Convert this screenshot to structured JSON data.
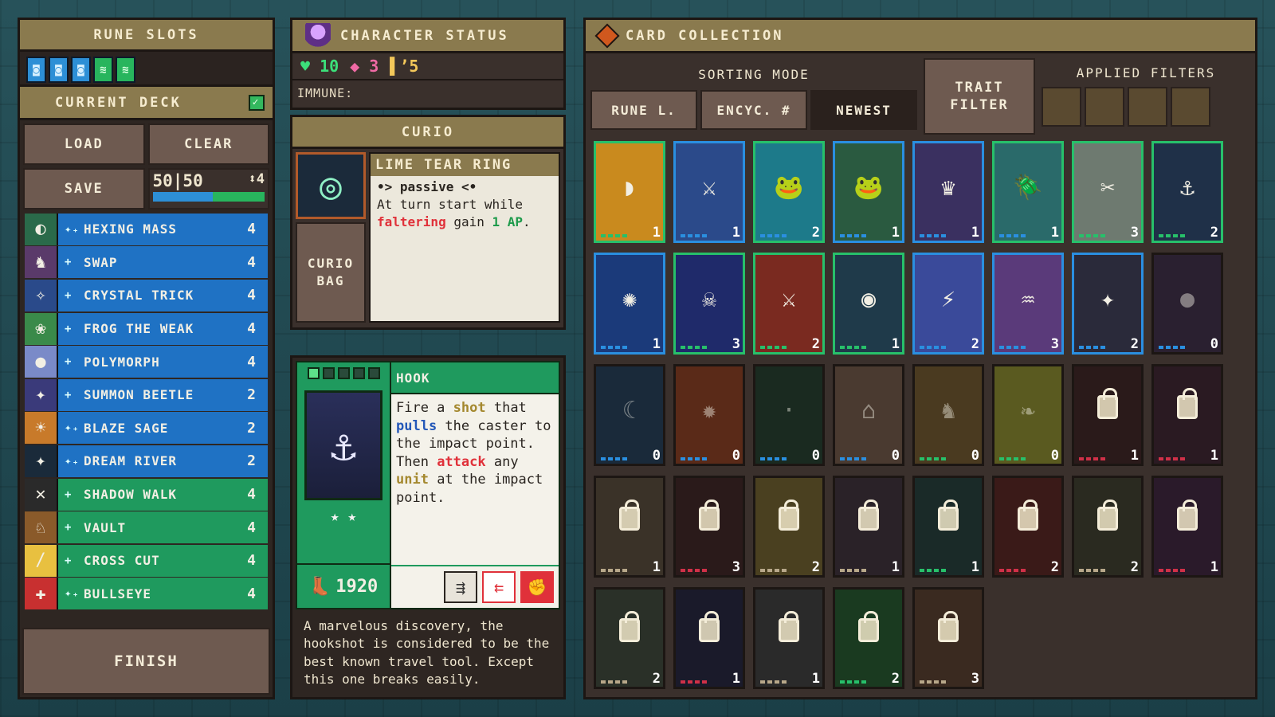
{
  "rune_slots": {
    "title": "RUNE SLOTS",
    "runes": [
      {
        "color": "blue",
        "icon": "blue-rune-icon"
      },
      {
        "color": "blue",
        "icon": "blue-rune-icon"
      },
      {
        "color": "blue",
        "icon": "blue-rune-icon"
      },
      {
        "color": "green",
        "icon": "green-rune-icon"
      },
      {
        "color": "green",
        "icon": "green-rune-icon"
      }
    ]
  },
  "deck": {
    "title": "CURRENT DECK",
    "load": "LOAD",
    "clear": "CLEAR",
    "save": "SAVE",
    "count": "50|50",
    "aux": "⬍4",
    "items": [
      {
        "name": "HEXING MASS",
        "count": "4",
        "color": "blue",
        "plus": "✦₊"
      },
      {
        "name": "SWAP",
        "count": "4",
        "color": "blue",
        "plus": "+"
      },
      {
        "name": "CRYSTAL TRICK",
        "count": "4",
        "color": "blue",
        "plus": "+"
      },
      {
        "name": "FROG THE WEAK",
        "count": "4",
        "color": "blue",
        "plus": "+"
      },
      {
        "name": "POLYMORPH",
        "count": "4",
        "color": "blue",
        "plus": "+"
      },
      {
        "name": "SUMMON BEETLE",
        "count": "2",
        "color": "blue",
        "plus": "+"
      },
      {
        "name": "BLAZE SAGE",
        "count": "2",
        "color": "blue",
        "plus": "✦₊"
      },
      {
        "name": "DREAM RIVER",
        "count": "2",
        "color": "blue",
        "plus": "✦₊"
      },
      {
        "name": "SHADOW WALK",
        "count": "4",
        "color": "green",
        "plus": "+"
      },
      {
        "name": "VAULT",
        "count": "4",
        "color": "green",
        "plus": "+"
      },
      {
        "name": "CROSS CUT",
        "count": "4",
        "color": "green",
        "plus": "+"
      },
      {
        "name": "BULLSEYE",
        "count": "4",
        "color": "green",
        "plus": "✦₊"
      }
    ],
    "finish": "FINISH"
  },
  "status": {
    "title": "CHARACTER STATUS",
    "hp": "♥ 10",
    "dmg": "◆ 3",
    "ap": "▌’5",
    "immune": "IMMUNE:"
  },
  "curio": {
    "title": "CURIO",
    "bag": "CURIO BAG",
    "item_name": "LIME TEAR RING",
    "passive": "•> passive <•",
    "desc_pre": "At turn start while ",
    "desc_kw1": "faltering",
    "desc_mid": " gain ",
    "desc_kw2": "1 AP",
    "desc_post": "."
  },
  "hook": {
    "name": "HOOK",
    "cost": "1920",
    "desc": [
      {
        "t": "Fire a ",
        "s": ""
      },
      {
        "t": "shot",
        "s": "ylw"
      },
      {
        "t": " that ",
        "s": ""
      },
      {
        "t": "pulls",
        "s": "blu"
      },
      {
        "t": " the caster to the impact point. Then ",
        "s": ""
      },
      {
        "t": "attack",
        "s": "red"
      },
      {
        "t": " any ",
        "s": ""
      },
      {
        "t": "unit",
        "s": "ylw"
      },
      {
        "t": " at the impact point.",
        "s": ""
      }
    ],
    "flavor": "A marvelous discovery, the hookshot is considered to be the best known travel tool. Except this one breaks easily."
  },
  "collection": {
    "title": "CARD COLLECTION",
    "sorting_label": "SORTING MODE",
    "sort_options": [
      "RUNE L.",
      "ENCYC. #",
      "NEWEST"
    ],
    "selected_sort": "NEWEST",
    "trait_filter": "TRAIT FILTER",
    "applied_filters": "APPLIED FILTERS",
    "cards": [
      {
        "count": "1",
        "c": "#c98a1e",
        "b": "green",
        "locked": false,
        "pip": "#27c06a"
      },
      {
        "count": "1",
        "c": "#2b4a8a",
        "b": "blue",
        "locked": false,
        "pip": "#2a8fe0"
      },
      {
        "count": "2",
        "c": "#1d7a8a",
        "b": "green",
        "locked": false,
        "pip": "#2a8fe0"
      },
      {
        "count": "1",
        "c": "#2a5a40",
        "b": "blue",
        "locked": false,
        "pip": "#2a8fe0"
      },
      {
        "count": "1",
        "c": "#3a3060",
        "b": "blue",
        "locked": false,
        "pip": "#2a8fe0"
      },
      {
        "count": "1",
        "c": "#2a6a6a",
        "b": "green",
        "locked": false,
        "pip": "#2a8fe0"
      },
      {
        "count": "3",
        "c": "#6e7a70",
        "b": "green",
        "locked": false,
        "pip": "#27c06a"
      },
      {
        "count": "2",
        "c": "#1f3048",
        "b": "green",
        "locked": false,
        "pip": "#27c06a"
      },
      {
        "count": "1",
        "c": "#1b3a7a",
        "b": "blue",
        "locked": false,
        "pip": "#2a8fe0"
      },
      {
        "count": "3",
        "c": "#1f2a6a",
        "b": "green",
        "locked": false,
        "pip": "#27c06a"
      },
      {
        "count": "2",
        "c": "#7a2a20",
        "b": "green",
        "locked": false,
        "pip": "#27c06a"
      },
      {
        "count": "1",
        "c": "#1f3a4a",
        "b": "green",
        "locked": false,
        "pip": "#27c06a"
      },
      {
        "count": "2",
        "c": "#3a4a9a",
        "b": "blue",
        "locked": false,
        "pip": "#2a8fe0"
      },
      {
        "count": "3",
        "c": "#5a3a7a",
        "b": "blue",
        "locked": false,
        "pip": "#2a8fe0"
      },
      {
        "count": "2",
        "c": "#2a2a3a",
        "b": "blue",
        "locked": false,
        "pip": "#2a8fe0"
      },
      {
        "count": "0",
        "c": "#2a2030",
        "b": "none",
        "locked": false,
        "pip": "#2a8fe0",
        "dim": true
      },
      {
        "count": "0",
        "c": "#1a2a3a",
        "b": "none",
        "locked": false,
        "pip": "#2a8fe0",
        "dim": true
      },
      {
        "count": "0",
        "c": "#5a2a18",
        "b": "none",
        "locked": false,
        "pip": "#2a8fe0",
        "dim": true
      },
      {
        "count": "0",
        "c": "#1a2a20",
        "b": "none",
        "locked": false,
        "pip": "#2a8fe0",
        "dim": true
      },
      {
        "count": "0",
        "c": "#4a3a30",
        "b": "none",
        "locked": false,
        "pip": "#2a8fe0",
        "dim": true
      },
      {
        "count": "0",
        "c": "#4a3a20",
        "b": "none",
        "locked": false,
        "pip": "#27c06a",
        "dim": true
      },
      {
        "count": "0",
        "c": "#5a5a20",
        "b": "none",
        "locked": false,
        "pip": "#27c06a",
        "dim": true
      },
      {
        "count": "1",
        "c": "#2a1a1a",
        "b": "none",
        "locked": true,
        "pip": "#d03048"
      },
      {
        "count": "1",
        "c": "#2a1a22",
        "b": "none",
        "locked": true,
        "pip": "#d03048"
      },
      {
        "count": "1",
        "c": "#3a3228",
        "b": "none",
        "locked": true,
        "pip": "#b8a88a"
      },
      {
        "count": "3",
        "c": "#2a1a1a",
        "b": "none",
        "locked": true,
        "pip": "#d03048"
      },
      {
        "count": "2",
        "c": "#4a4020",
        "b": "none",
        "locked": true,
        "pip": "#b8a88a"
      },
      {
        "count": "1",
        "c": "#2a2228",
        "b": "none",
        "locked": true,
        "pip": "#b8a88a"
      },
      {
        "count": "1",
        "c": "#1a2a28",
        "b": "none",
        "locked": true,
        "pip": "#27c06a"
      },
      {
        "count": "2",
        "c": "#3a1a18",
        "b": "none",
        "locked": true,
        "pip": "#d03048"
      },
      {
        "count": "2",
        "c": "#2a2a20",
        "b": "none",
        "locked": true,
        "pip": "#b8a88a"
      },
      {
        "count": "1",
        "c": "#2a1a2a",
        "b": "none",
        "locked": true,
        "pip": "#d03048"
      },
      {
        "count": "2",
        "c": "#2a3028",
        "b": "none",
        "locked": true,
        "pip": "#b8a88a"
      },
      {
        "count": "1",
        "c": "#1a1a2a",
        "b": "none",
        "locked": true,
        "pip": "#d03048"
      },
      {
        "count": "1",
        "c": "#2a2a2a",
        "b": "none",
        "locked": true,
        "pip": "#b8a88a"
      },
      {
        "count": "2",
        "c": "#1a3a20",
        "b": "none",
        "locked": true,
        "pip": "#27c06a"
      },
      {
        "count": "3",
        "c": "#3a2a20",
        "b": "none",
        "locked": true,
        "pip": "#b8a88a"
      }
    ]
  }
}
